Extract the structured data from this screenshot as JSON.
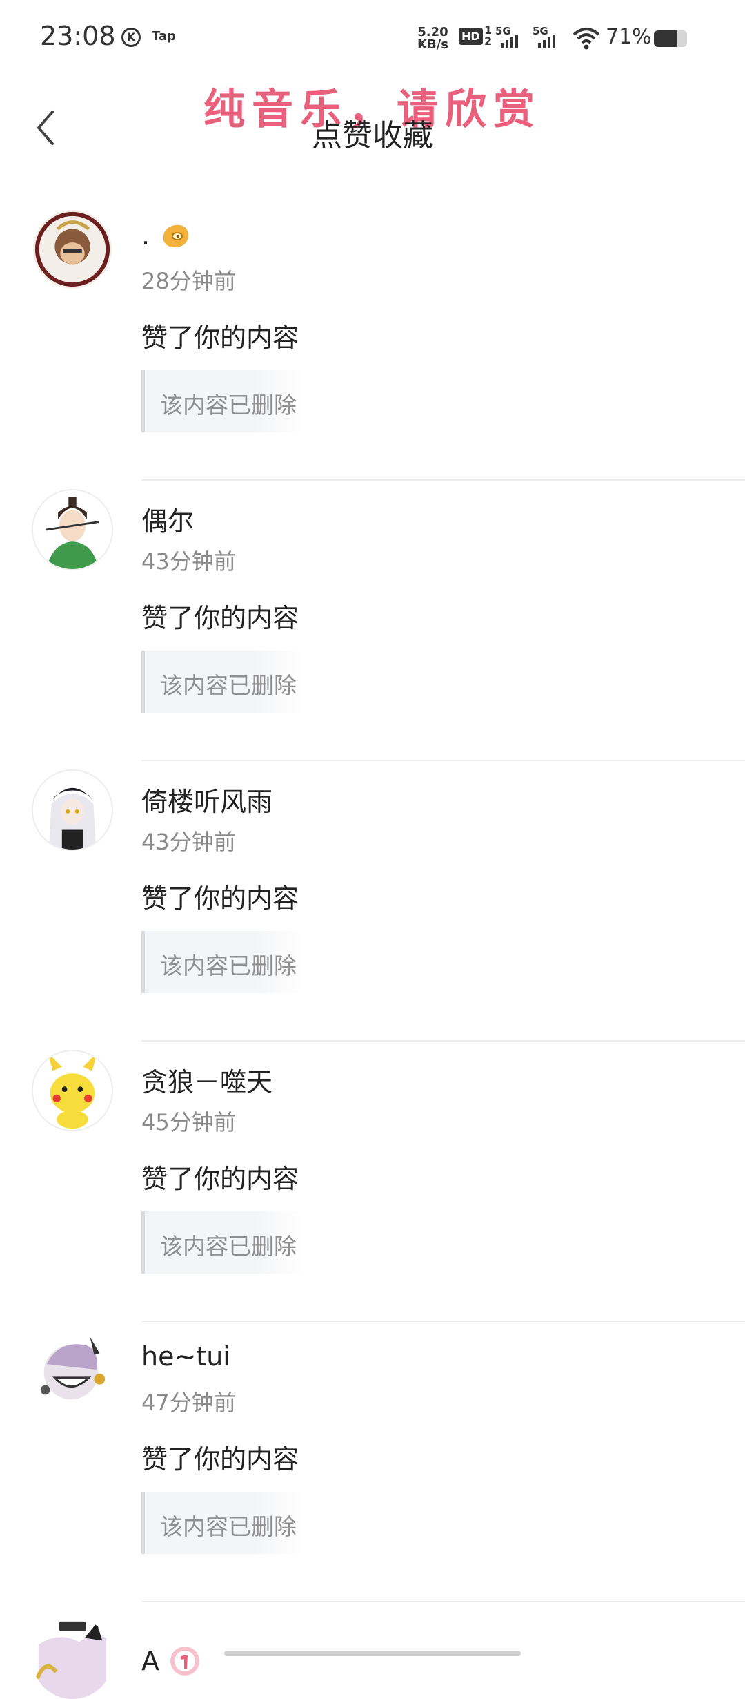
{
  "status": {
    "time": "23:08",
    "k_icon": "K",
    "tap_label": "Tap",
    "speed_value": "5.20",
    "speed_unit": "KB/s",
    "hd_label": "HD",
    "hd_sup": "1",
    "hd_sub": "2",
    "sim1_label": "5G",
    "sim2_label": "5G",
    "battery": "71%"
  },
  "header": {
    "overlay_text": "纯音乐，请欣赏",
    "title": "点赞收藏"
  },
  "colors": {
    "overlay": "#e8607c",
    "timestamp": "#8a8a8a",
    "quote_bg": "#f4f5f7"
  },
  "feed": [
    {
      "username": ".",
      "badge_icon": "orange-emoji-badge-icon",
      "time": "28分钟前",
      "action": "赞了你的内容",
      "quote": "该内容已删除"
    },
    {
      "username": "偶尔",
      "time": "43分钟前",
      "action": "赞了你的内容",
      "quote": "该内容已删除"
    },
    {
      "username": "倚楼听风雨",
      "time": "43分钟前",
      "action": "赞了你的内容",
      "quote": "该内容已删除"
    },
    {
      "username": "贪狼－噬天",
      "time": "45分钟前",
      "action": "赞了你的内容",
      "quote": "该内容已删除"
    },
    {
      "username": "he~tui",
      "time": "47分钟前",
      "action": "赞了你的内容",
      "quote": "该内容已删除"
    },
    {
      "username": "A",
      "badge_icon": "pink-level-badge-icon"
    }
  ]
}
